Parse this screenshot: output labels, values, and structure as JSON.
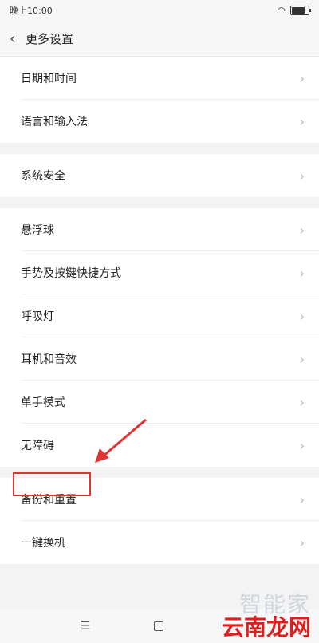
{
  "status": {
    "time": "晚上10:00"
  },
  "header": {
    "title": "更多设置"
  },
  "groups": [
    [
      "日期和时间",
      "语言和输入法"
    ],
    [
      "系统安全"
    ],
    [
      "悬浮球",
      "手势及按键快捷方式",
      "呼吸灯",
      "耳机和音效",
      "单手模式",
      "无障碍"
    ],
    [
      "备份和重置",
      "一键换机"
    ]
  ],
  "watermark": {
    "top": "智能家",
    "main": "云南龙网"
  },
  "colors": {
    "highlight": "#e03333",
    "background": "#f3f3f3"
  },
  "icons": {
    "back": "chevron-left-icon",
    "row": "chevron-right-icon"
  }
}
